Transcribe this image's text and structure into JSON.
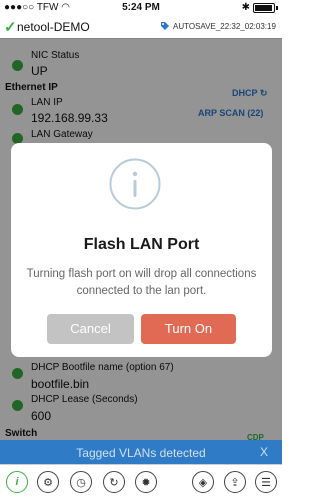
{
  "status_bar": {
    "carrier": "TFW",
    "time": "5:24 PM"
  },
  "title_bar": {
    "app_title": "netool-DEMO",
    "autosave": "AUTOSAVE_22:32_02:03:19"
  },
  "list": {
    "nic_status_label": "NIC Status",
    "nic_status_value": "UP",
    "ethernet_ip_section": "Ethernet IP",
    "dhcp_link": "DHCP ↻",
    "arp_scan_link": "ARP SCAN (22)",
    "lan_ip_label": "LAN IP",
    "lan_ip_value": "192.168.99.33",
    "lan_gateway_label": "LAN Gateway",
    "dhcp_bootfile_label": "DHCP Bootfile name (option 67)",
    "dhcp_bootfile_value": "bootfile.bin",
    "dhcp_lease_label": "DHCP Lease (Seconds)",
    "dhcp_lease_value": "600",
    "switch_section": "Switch",
    "cdp_label": "CDP"
  },
  "dialog": {
    "title": "Flash LAN Port",
    "message": "Turning flash port on will drop all connections connected to the lan port.",
    "cancel_label": "Cancel",
    "confirm_label": "Turn On"
  },
  "banner": {
    "text": "Tagged VLANs detected",
    "close_label": "X"
  },
  "colors": {
    "accent_green": "#3cb043",
    "link_blue": "#2b78d0",
    "confirm_red": "#e06a54",
    "banner_blue": "#2f7bc6"
  }
}
